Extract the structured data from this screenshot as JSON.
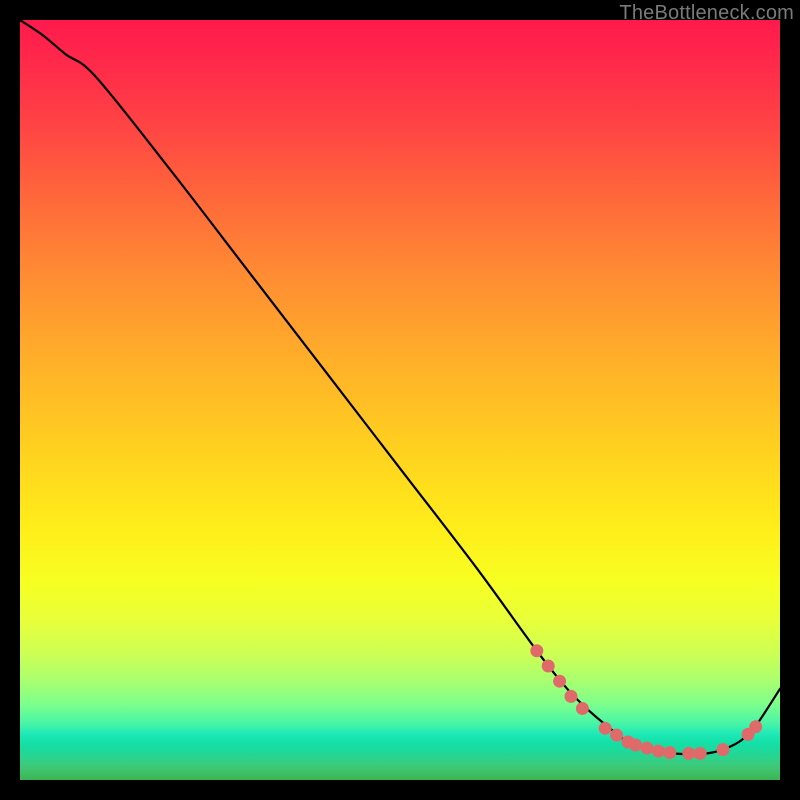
{
  "watermark": "TheBottleneck.com",
  "chart_data": {
    "type": "line",
    "title": "",
    "xlabel": "",
    "ylabel": "",
    "xlim": [
      0,
      100
    ],
    "ylim": [
      0,
      100
    ],
    "grid": false,
    "legend": false,
    "series": [
      {
        "name": "curve",
        "x": [
          0,
          3,
          6,
          10,
          20,
          30,
          40,
          50,
          60,
          68,
          72,
          75,
          78,
          80,
          83,
          86,
          89,
          91,
          93,
          95,
          97,
          100
        ],
        "y": [
          100,
          98,
          95.5,
          92.5,
          80,
          67,
          54,
          41,
          28,
          17,
          12,
          9,
          6.5,
          5,
          4,
          3.5,
          3.4,
          3.6,
          4.2,
          5.3,
          7.4,
          12
        ]
      }
    ],
    "markers": [
      {
        "x": 68.0,
        "y": 17.0
      },
      {
        "x": 69.5,
        "y": 15.0
      },
      {
        "x": 71.0,
        "y": 13.0
      },
      {
        "x": 72.5,
        "y": 11.0
      },
      {
        "x": 74.0,
        "y": 9.4
      },
      {
        "x": 77.0,
        "y": 6.8
      },
      {
        "x": 78.5,
        "y": 5.9
      },
      {
        "x": 80.0,
        "y": 5.0
      },
      {
        "x": 81.0,
        "y": 4.6
      },
      {
        "x": 82.5,
        "y": 4.2
      },
      {
        "x": 84.0,
        "y": 3.8
      },
      {
        "x": 85.5,
        "y": 3.6
      },
      {
        "x": 88.0,
        "y": 3.5
      },
      {
        "x": 89.5,
        "y": 3.5
      },
      {
        "x": 92.5,
        "y": 4.0
      },
      {
        "x": 95.8,
        "y": 6.0
      },
      {
        "x": 96.8,
        "y": 7.0
      }
    ],
    "colors": {
      "curve": "#000000",
      "markers": "#e06a6a",
      "gradient_top": "#ff1a4d",
      "gradient_bottom": "#3bb551"
    }
  }
}
